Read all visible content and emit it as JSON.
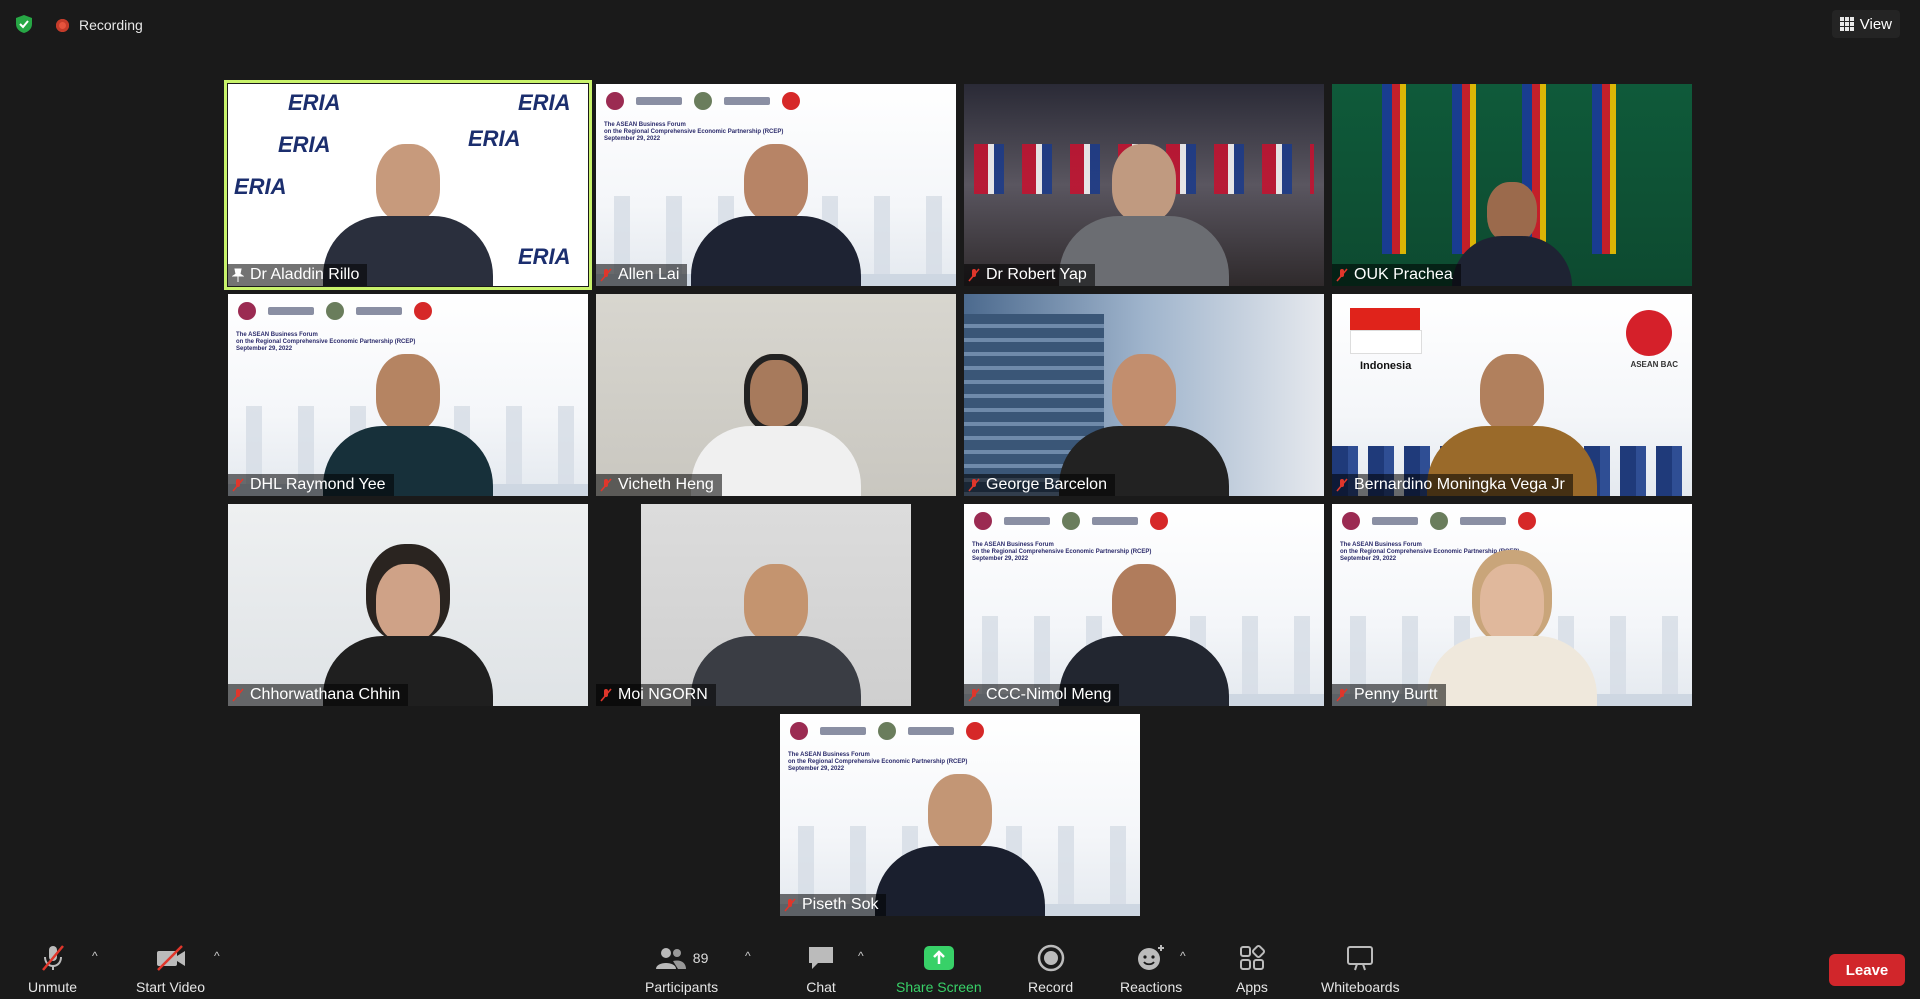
{
  "top": {
    "recording_label": "Recording",
    "view_label": "View"
  },
  "participants": [
    {
      "name": "Dr Aladdin Rillo"
    },
    {
      "name": "Allen Lai"
    },
    {
      "name": "Dr Robert Yap"
    },
    {
      "name": "OUK Prachea"
    },
    {
      "name": "DHL Raymond Yee"
    },
    {
      "name": "Vicheth Heng"
    },
    {
      "name": "George Barcelon"
    },
    {
      "name": "Bernardino Moningka Vega Jr"
    },
    {
      "name": "Chhorwathana Chhin"
    },
    {
      "name": "Moi NGORN"
    },
    {
      "name": "CCC-Nimol Meng"
    },
    {
      "name": "Penny Burtt"
    },
    {
      "name": "Piseth Sok"
    }
  ],
  "banner": {
    "erias": "ERIA",
    "forum_title": "The ASEAN Business Forum",
    "forum_sub": "on the Regional Comprehensive Economic Partnership (RCEP)",
    "forum_date": "September 29, 2022",
    "indonesia": "Indonesia",
    "asean_bac": "ASEAN BAC"
  },
  "toolbar": {
    "unmute": "Unmute",
    "start_video": "Start Video",
    "participants": "Participants",
    "participants_count": "89",
    "chat": "Chat",
    "share_screen": "Share Screen",
    "record": "Record",
    "reactions": "Reactions",
    "apps": "Apps",
    "whiteboards": "Whiteboards",
    "leave": "Leave"
  },
  "colors": {
    "active_speaker_border": "#c8f26b",
    "share_green": "#38d168",
    "leave_red": "#d1262b",
    "muted_red": "#e0362b"
  }
}
